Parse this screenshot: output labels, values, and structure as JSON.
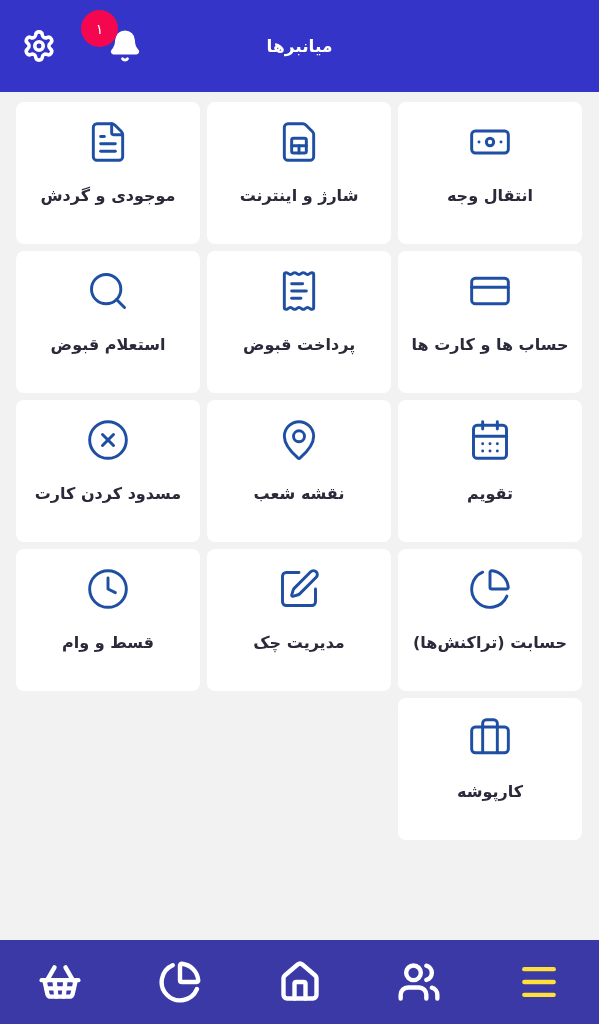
{
  "header": {
    "title": "میانبرها",
    "notification_count": "۱"
  },
  "shortcuts": [
    {
      "label": "انتقال وجه"
    },
    {
      "label": "شارژ و اینترنت"
    },
    {
      "label": "موجودی و گردش"
    },
    {
      "label": "حساب ها و کارت ها"
    },
    {
      "label": "پرداخت قبوض"
    },
    {
      "label": "استعلام قبوض"
    },
    {
      "label": "تقویم"
    },
    {
      "label": "نقشه شعب"
    },
    {
      "label": "مسدود کردن کارت"
    },
    {
      "label": "حسابت (تراکنش‌ها)"
    },
    {
      "label": "مدیریت چک"
    },
    {
      "label": "قسط و وام"
    },
    {
      "label": "کارپوشه"
    }
  ],
  "bottom_nav": [
    {
      "selected": true
    },
    {
      "selected": false
    },
    {
      "selected": false
    },
    {
      "selected": false
    },
    {
      "selected": false
    }
  ]
}
